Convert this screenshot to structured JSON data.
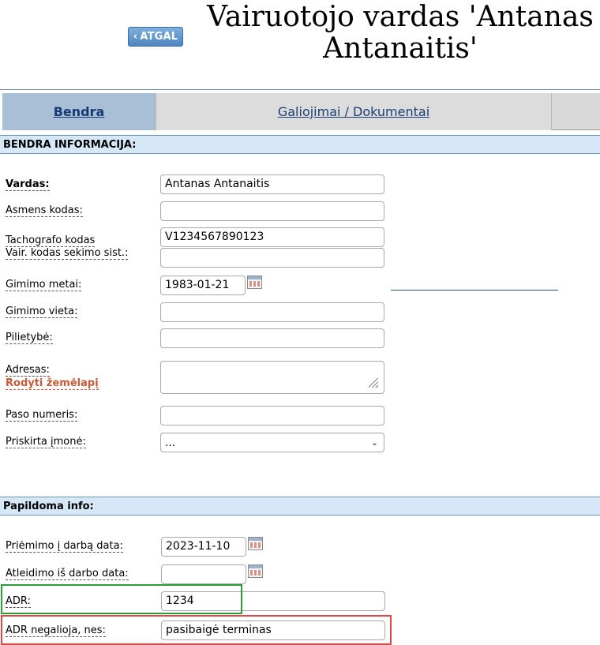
{
  "header": {
    "back_label": "ATGAL",
    "title": "Vairuotojo vardas 'Antanas Antanaitis'"
  },
  "tabs": [
    {
      "label": "Bendra",
      "active": true
    },
    {
      "label": "Galiojimai / Dokumentai",
      "active": false
    }
  ],
  "sections": {
    "general": "BENDRA INFORMACIJA:",
    "extra": "Papildoma info:"
  },
  "fields": {
    "name": {
      "label": "Vardas:",
      "value": "Antanas Antanaitis"
    },
    "personal_code": {
      "label": "Asmens kodas:",
      "value": ""
    },
    "tacho_code": {
      "label": "Tachografo kodas",
      "value": "V1234567890123"
    },
    "tracking_code": {
      "label": "Vair. kodas sekimo sist.:",
      "value": ""
    },
    "birth_date": {
      "label": "Gimimo metai:",
      "value": "1983-01-21"
    },
    "birth_place": {
      "label": "Gimimo vieta:",
      "value": ""
    },
    "citizenship": {
      "label": "Pilietybė:",
      "value": ""
    },
    "address": {
      "label": "Adresas:",
      "map_link": "Rodyti žemėlapį",
      "value": ""
    },
    "passport": {
      "label": "Paso numeris:",
      "value": ""
    },
    "company": {
      "label": "Priskirta įmonė:",
      "value": "..."
    },
    "hire_date": {
      "label": "Priėmimo į darbą data:",
      "value": "2023-11-10"
    },
    "fire_date": {
      "label": "Atleidimo iš darbo data:",
      "value": ""
    },
    "adr": {
      "label": "ADR:",
      "value": "1234"
    },
    "adr_invalid": {
      "label": "ADR negalioja, nes:",
      "value": "pasibaigė terminas"
    }
  },
  "colors": {
    "accent": "#4f86c0",
    "section_bg": "#d6e8f7",
    "highlight_green": "#2e9e3a",
    "highlight_red": "#e04848"
  }
}
